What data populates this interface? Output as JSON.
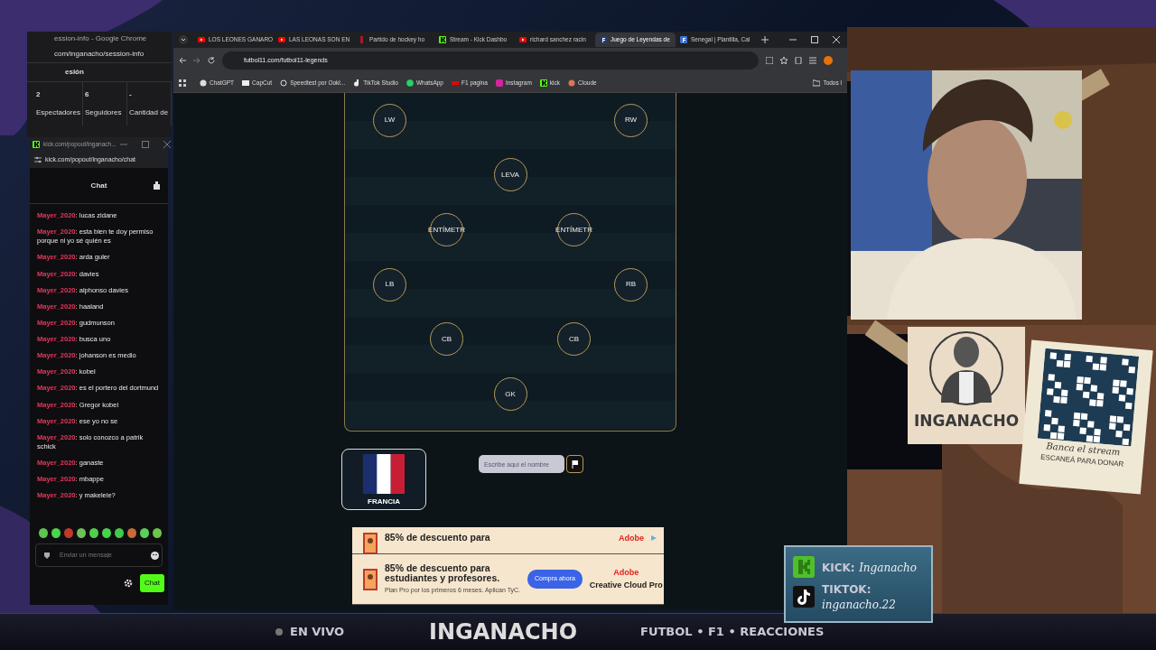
{
  "session_window": {
    "title": "ession-info - Google Chrome",
    "url": "com/inganacho/session-info",
    "heading": "esión",
    "stats": [
      {
        "value": "2",
        "label": "Espectadores"
      },
      {
        "value": "6",
        "label": "Seguidores"
      },
      {
        "value": "-",
        "label": "Cantidad de"
      }
    ]
  },
  "chat_window": {
    "title": "kick.com/popout/inganach...",
    "url": "kick.com/popout/inganacho/chat",
    "heading": "Chat",
    "messages": [
      {
        "text": "**Mayer_2020**: lucas zidane"
      },
      {
        "text": "**Mayer_2020**: esta bien te doy permiso porque ni yo sé quién es"
      },
      {
        "text": "**Mayer_2020**: arda guler"
      },
      {
        "text": "**Mayer_2020**: davies"
      },
      {
        "text": "**Mayer_2020**: alphonso davies"
      },
      {
        "text": "**Mayer_2020**: haaland"
      },
      {
        "text": "**Mayer_2020**: gudmunson"
      },
      {
        "text": "**Mayer_2020**: busca uno"
      },
      {
        "text": "**Mayer_2020**: johanson es medio"
      },
      {
        "text": "**Mayer_2020**: kobel"
      },
      {
        "text": "**Mayer_2020**: es el portero del dortmund"
      },
      {
        "text": "**Mayer_2020**: Gregor kobel"
      },
      {
        "text": "**Mayer_2020**: ese yo no se"
      },
      {
        "text": "**Mayer_2020**: solo conozco a patrik schick"
      },
      {
        "text": "**Mayer_2020**: ganaste"
      },
      {
        "text": "**Mayer_2020**: mbappe"
      },
      {
        "text": "**Mayer_2020**: y makelele?"
      }
    ],
    "input": {
      "placeholder": "Enviar un mensaje"
    },
    "send_button": "Chat"
  },
  "browser": {
    "tabs": [
      {
        "label": "LOS LEONES GANARO",
        "kind": "video",
        "selected": false
      },
      {
        "label": "LAS LEONAS SON EN",
        "kind": "video",
        "selected": false
      },
      {
        "label": "Partido de hockey ho",
        "kind": "bar",
        "selected": false
      },
      {
        "label": "Stream - Kick Dashbo",
        "kind": "kick",
        "selected": false
      },
      {
        "label": "richard sanchez racin",
        "kind": "video",
        "selected": false
      },
      {
        "label": "Juego de Leyendas de",
        "kind": "site",
        "selected": true
      },
      {
        "label": "Senegal | Plantilla, Cal",
        "kind": "letter",
        "selected": false
      }
    ],
    "url": "futbol11.com/futbol11-legends",
    "bookmarks": [
      {
        "label": "ChatGPT",
        "kind": "chatgpt"
      },
      {
        "label": "CapCut",
        "kind": "capcut"
      },
      {
        "label": "Speedtest por Ookl...",
        "kind": "speedtest"
      },
      {
        "label": "TikTok Studio",
        "kind": "tiktok"
      },
      {
        "label": "WhatsApp",
        "kind": "whatsapp"
      },
      {
        "label": "F1 pagina",
        "kind": "f1"
      },
      {
        "label": "Instagram",
        "kind": "instagram"
      },
      {
        "label": "kick",
        "kind": "kick"
      },
      {
        "label": "Cloude",
        "kind": "claude"
      },
      {
        "label": "Todos l",
        "kind": "folder"
      }
    ]
  },
  "formation": [
    {
      "kind": "wide",
      "players": [
        "LW",
        "RW"
      ]
    },
    {
      "kind": "center",
      "players": [
        "LEVA"
      ]
    },
    {
      "kind": "narrow",
      "players": [
        "ENTÍMETR",
        "ENTÍMETR"
      ]
    },
    {
      "kind": "wide",
      "players": [
        "LB",
        "RB"
      ]
    },
    {
      "kind": "narrow",
      "players": [
        "CB",
        "CB"
      ]
    },
    {
      "kind": "center",
      "players": [
        "GK"
      ]
    }
  ],
  "country": {
    "name": "FRANCIA"
  },
  "guess": {
    "placeholder": "Escribe aquí el nombre"
  },
  "ads": [
    {
      "headline": "85% de descuento para",
      "brand": "Adobe"
    },
    {
      "headline": "85% de descuento para estudiantes y profesores.",
      "note": "Plan Pro por los primeros 6 meses. Aplican TyC.",
      "button": "Compra ahora",
      "brand": "Adobe",
      "product": "Creative Cloud Pro"
    }
  ],
  "logo": {
    "name": "INGANACHO"
  },
  "donation": {
    "caption": "Banca el stream",
    "note": "ESCANEÁ PARA DONAR"
  },
  "socials": [
    {
      "kind": "kick",
      "label": "KICK:",
      "handle": "Inganacho"
    },
    {
      "kind": "tiktok",
      "label": "TIKTOK:",
      "handle": "inganacho.22"
    }
  ],
  "bottom_bar": {
    "live": "EN VIVO",
    "name": "INGANACHO",
    "topics": "FUTBOL • F1 • REACCIONES"
  }
}
